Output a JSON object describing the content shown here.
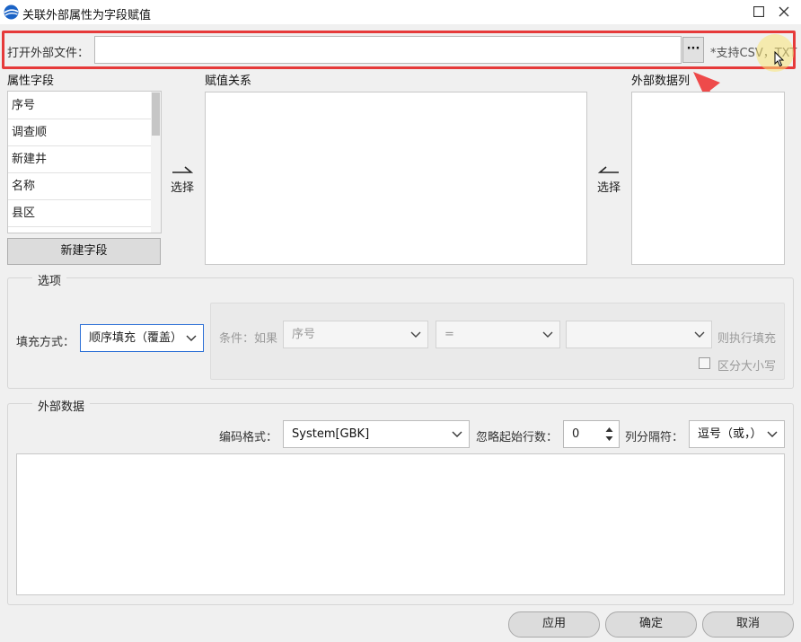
{
  "window": {
    "title": "关联外部属性为字段赋值"
  },
  "file_row": {
    "label": "打开外部文件：",
    "path_value": "",
    "browse_label": "···",
    "support_hint": "*支持CSV，TXT"
  },
  "attr_fields": {
    "header": "属性字段",
    "items": [
      "序号",
      "调查顺",
      "新建井",
      "名称",
      "县区"
    ],
    "new_field_label": "新建字段"
  },
  "assign": {
    "header": "赋值关系",
    "select_left": "选择",
    "select_right": "选择"
  },
  "external_cols": {
    "header": "外部数据列"
  },
  "options": {
    "title": "选项",
    "fill_mode_label": "填充方式：",
    "fill_mode_value": "顺序填充（覆盖）",
    "condition_label": "条件：如果",
    "condition_field": "序号",
    "condition_op": "=",
    "condition_value": "",
    "then_label": "则执行填充",
    "case_sensitive_label": "区分大小写",
    "case_sensitive": false
  },
  "external_data": {
    "title": "外部数据",
    "encoding_label": "编码格式：",
    "encoding_value": "System[GBK]",
    "skip_label": "忽略起始行数：",
    "skip_value": "0",
    "delim_label": "列分隔符：",
    "delim_value": "逗号（或，）"
  },
  "footer": {
    "apply": "应用",
    "ok": "确定",
    "cancel": "取消"
  },
  "annotation": {
    "highlight_color": "#e63a3a",
    "arrow_color": "#ee4a4a"
  }
}
